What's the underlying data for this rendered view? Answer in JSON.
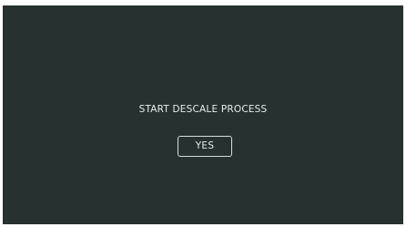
{
  "dialog": {
    "prompt": "START DESCALE PROCESS",
    "confirm_label": "YES"
  },
  "colors": {
    "background": "#27312f",
    "text": "#e8eceb",
    "button_border": "#d7dcdb"
  }
}
